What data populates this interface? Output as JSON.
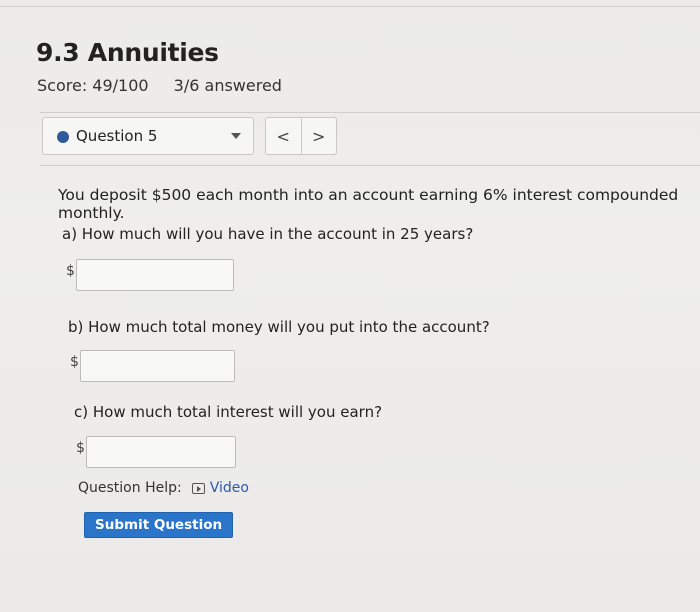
{
  "header": {
    "title": "9.3 Annuities",
    "score": "Score: 49/100",
    "answered": "3/6 answered"
  },
  "question_nav": {
    "selected": "Question 5",
    "prev_glyph": "<",
    "next_glyph": ">",
    "status_color": "#2e5a9c"
  },
  "question": {
    "prompt": "You deposit $500 each month into an account earning 6% interest compounded monthly.",
    "parts": [
      {
        "label": "a) How much will you have in the account in 25 years?",
        "prefix": "$",
        "value": ""
      },
      {
        "label": "b) How much total money will you put into the account?",
        "prefix": "$",
        "value": ""
      },
      {
        "label": "c) How much total interest will you earn?",
        "prefix": "$",
        "value": ""
      }
    ]
  },
  "help": {
    "label": "Question Help:",
    "video_label": "Video"
  },
  "actions": {
    "submit_label": "Submit Question",
    "accent_color": "#2a75c9"
  }
}
